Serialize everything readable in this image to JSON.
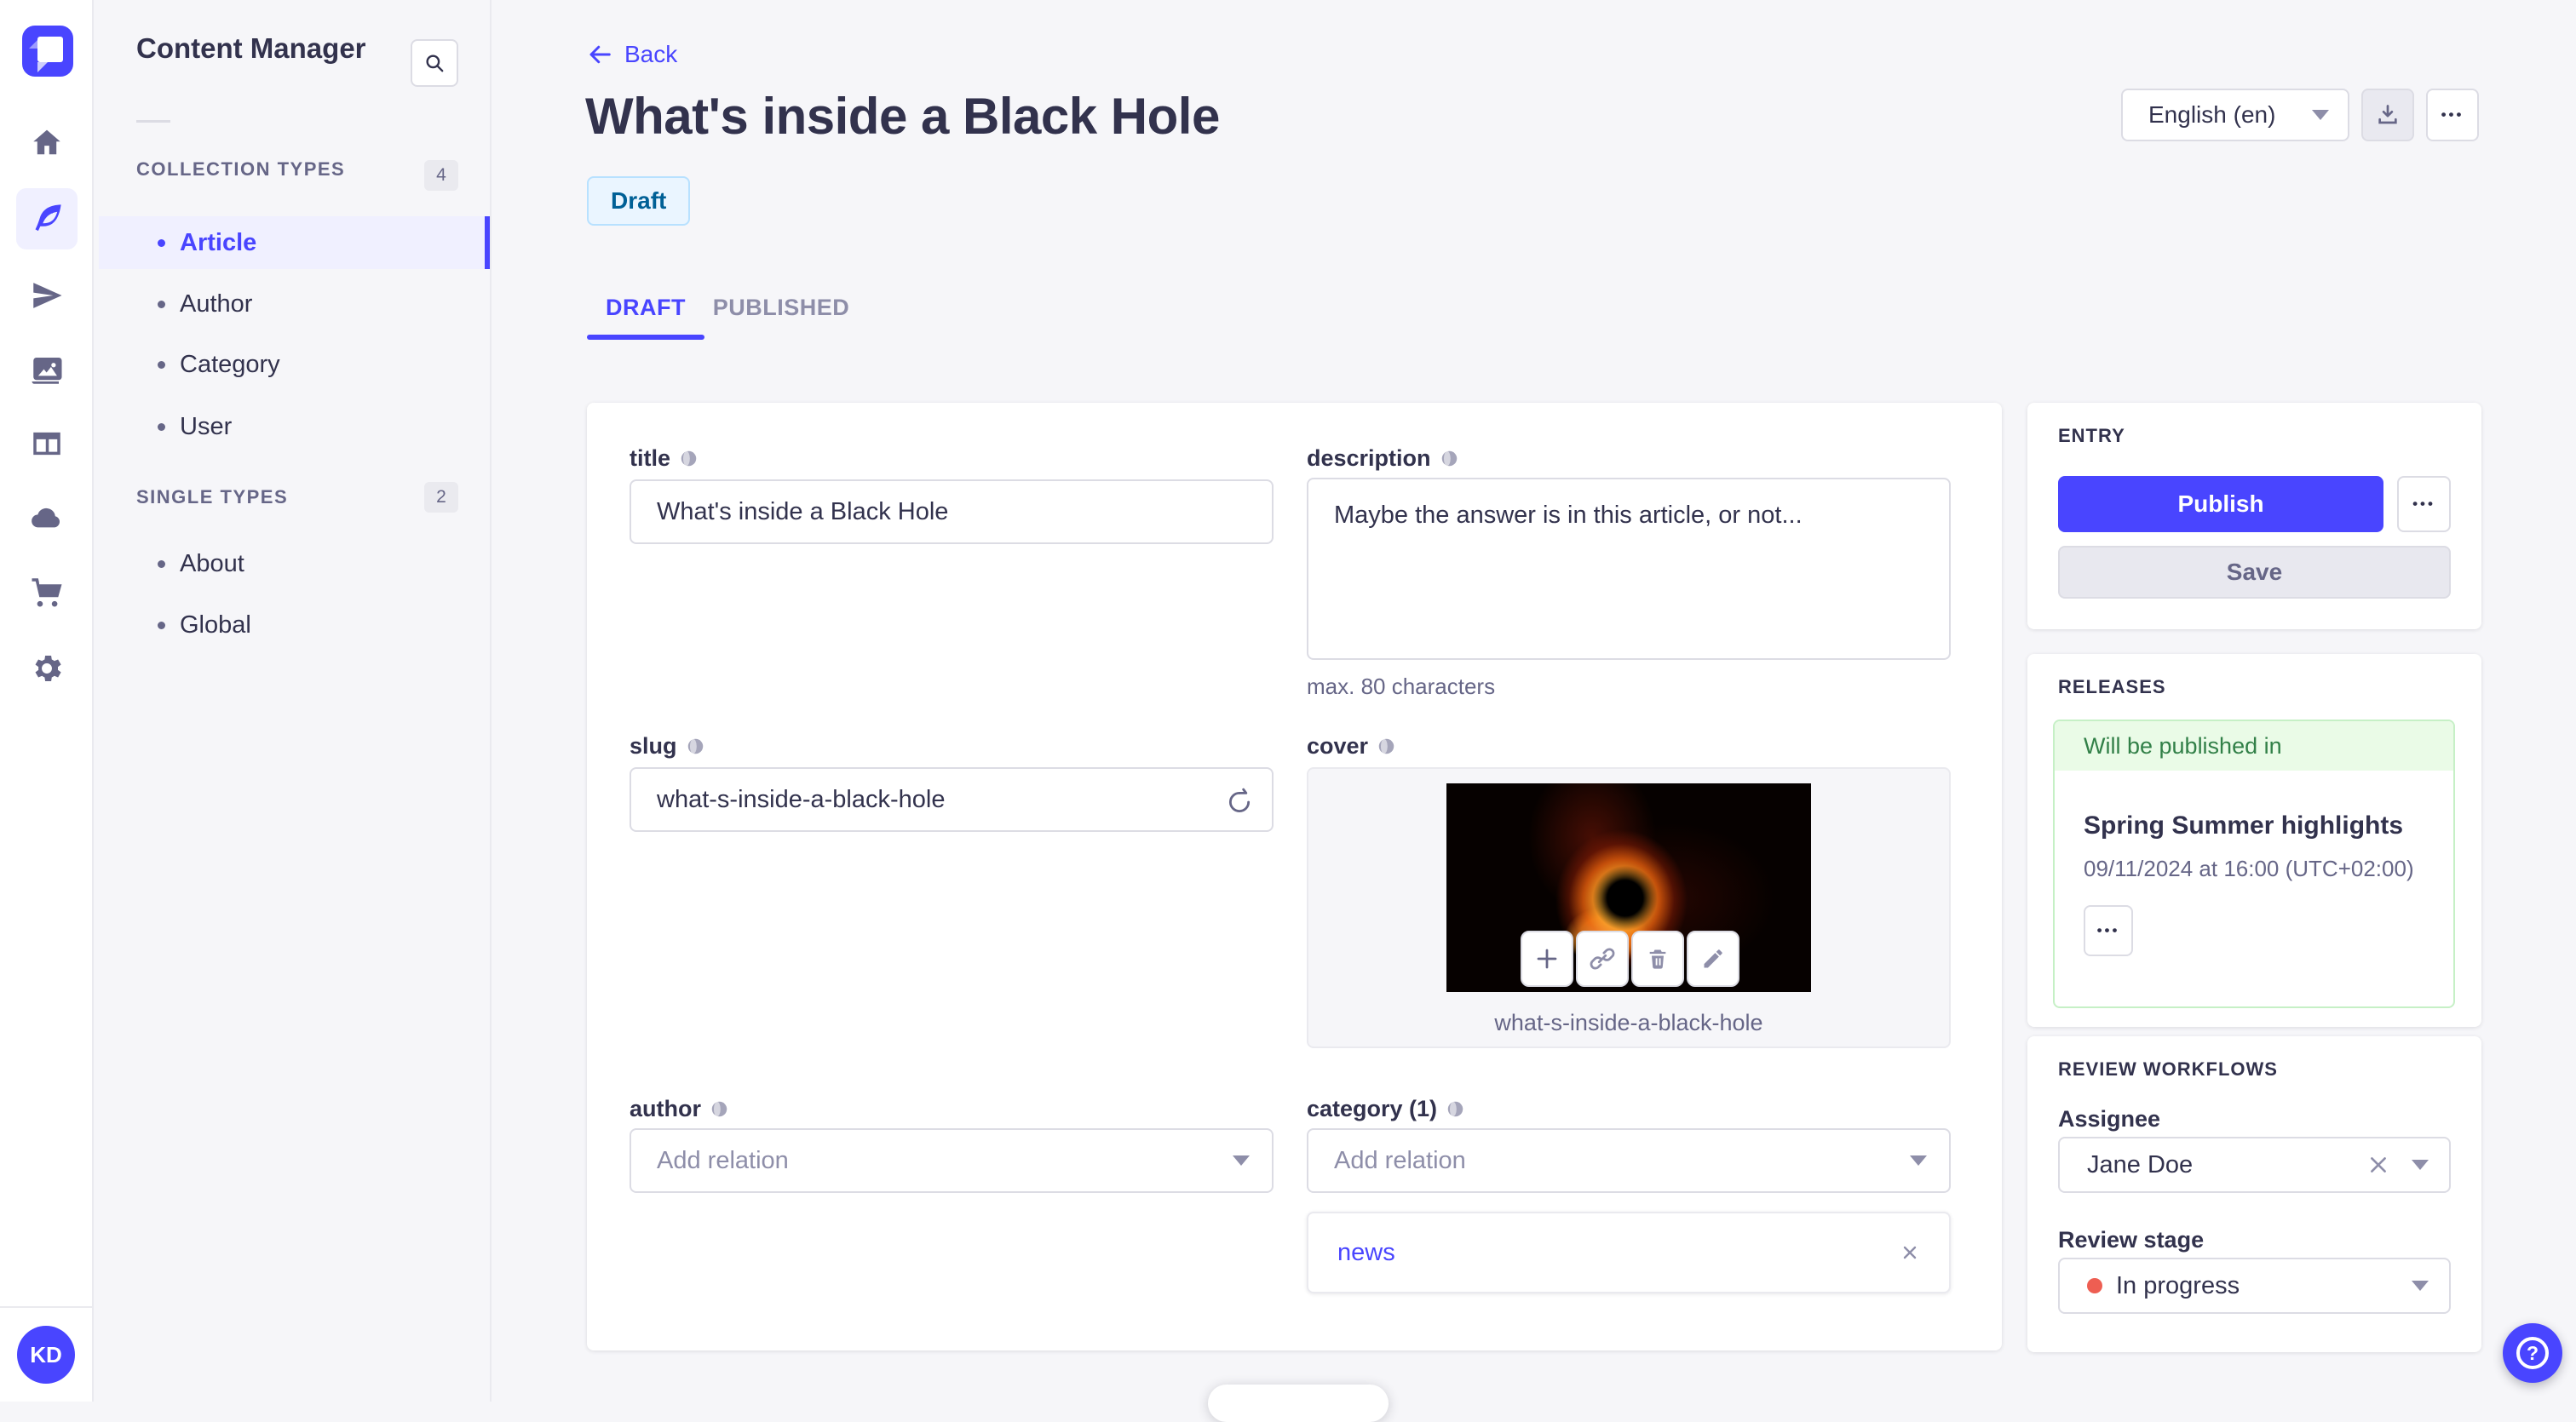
{
  "rail": {
    "avatar": "KD"
  },
  "subnav": {
    "title": "Content Manager",
    "collection": {
      "label": "COLLECTION TYPES",
      "count": "4",
      "items": [
        "Article",
        "Author",
        "Category",
        "User"
      ],
      "active": "Article"
    },
    "single": {
      "label": "SINGLE TYPES",
      "count": "2",
      "items": [
        "About",
        "Global"
      ]
    }
  },
  "header": {
    "back": "Back",
    "title": "What's inside a Black Hole",
    "status": "Draft",
    "locale": "English (en)"
  },
  "tabs": {
    "draft": "DRAFT",
    "published": "PUBLISHED"
  },
  "form": {
    "title": {
      "label": "title",
      "value": "What's inside a Black Hole"
    },
    "description": {
      "label": "description",
      "value": "Maybe the answer is in this article, or not...",
      "hint": "max. 80 characters"
    },
    "slug": {
      "label": "slug",
      "value": "what-s-inside-a-black-hole"
    },
    "cover": {
      "label": "cover",
      "filename": "what-s-inside-a-black-hole"
    },
    "author": {
      "label": "author",
      "placeholder": "Add relation"
    },
    "category": {
      "label": "category (1)",
      "placeholder": "Add relation",
      "selected": "news"
    }
  },
  "entry": {
    "title": "ENTRY",
    "publish": "Publish",
    "save": "Save"
  },
  "releases": {
    "title": "RELEASES",
    "status": "Will be published in",
    "name": "Spring Summer highlights",
    "date": "09/11/2024 at 16:00 (UTC+02:00)"
  },
  "review": {
    "title": "REVIEW WORKFLOWS",
    "assignee_label": "Assignee",
    "assignee": "Jane Doe",
    "stage_label": "Review stage",
    "stage": "In progress"
  },
  "ui": {
    "more": "•••"
  },
  "colors": {
    "primary": "#4945ff",
    "draft_text": "#006096",
    "success": "#328048",
    "danger": "#ee5e52",
    "background": "#f6f6f9"
  }
}
